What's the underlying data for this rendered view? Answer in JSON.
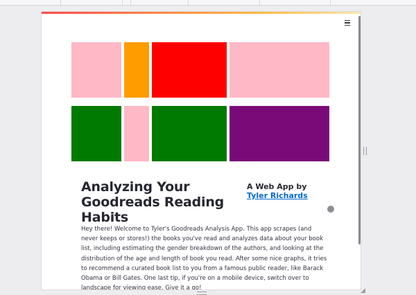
{
  "app": {
    "title": "Analyzing Your Goodreads Reading Habits",
    "byline_prefix": "A Web App by ",
    "author_name": "Tyler Richards",
    "intro": "Hey there! Welcome to Tyler's Goodreads Analysis App. This app scrapes (and never keeps or stores!) the books you've read and analyzes data about your book list, including estimating the gender breakdown of the authors, and looking at the distribution of the age and length of book you read. After some nice graphs, it tries to recommend a curated book list to you from a famous public reader, like Barack Obama or Bill Gates. One last tip, if you're on a mobile device, switch over to landscape for viewing ease. Give it a go!"
  },
  "header": {
    "menu_icon": "hamburger-menu-icon"
  },
  "colors": {
    "pink": "#ffb8c6",
    "orange": "#ff9c00",
    "red": "#ff0000",
    "green": "#007a00",
    "purple": "#7a0a78",
    "link": "#0068c9"
  },
  "tiles": [
    {
      "name": "tile-pink-1",
      "color": "#ffb8c6"
    },
    {
      "name": "tile-orange",
      "color": "#ff9c00"
    },
    {
      "name": "tile-red",
      "color": "#ff0000"
    },
    {
      "name": "tile-pink-2",
      "color": "#ffb8c6"
    },
    {
      "name": "tile-green-1",
      "color": "#007a00"
    },
    {
      "name": "tile-pink-3",
      "color": "#ffb8c6"
    },
    {
      "name": "tile-green-2",
      "color": "#007a00"
    },
    {
      "name": "tile-purple",
      "color": "#7a0a78"
    }
  ]
}
